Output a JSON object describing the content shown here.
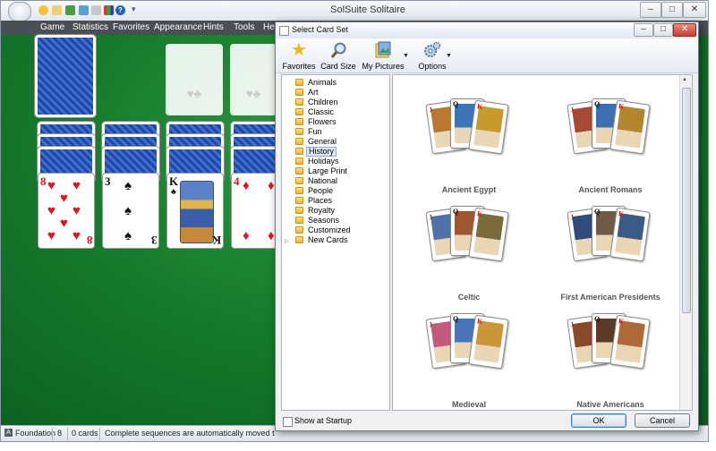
{
  "main_window": {
    "title": "SolSuite Solitaire",
    "controls": {
      "minimize": "–",
      "maximize": "□",
      "close": "✕"
    }
  },
  "menu": [
    "Game",
    "Statistics",
    "Favorites",
    "Appearance",
    "Hints",
    "Tools",
    "Help"
  ],
  "game": {
    "tableau": [
      {
        "face_rank": "8",
        "suit": "♥"
      },
      {
        "face_rank": "3",
        "suit": "♠"
      },
      {
        "face_rank": "K",
        "suit": "♣"
      },
      {
        "face_rank": "4",
        "suit": "♦"
      }
    ],
    "foundation_hints": [
      "♥♣",
      "♥♣"
    ]
  },
  "status": {
    "pile": "Foundation",
    "pile_number": "8",
    "cards": "0 cards",
    "message": "Complete sequences are automatically moved to the foundations."
  },
  "dialog": {
    "title": "Select Card Set",
    "toolbar": [
      {
        "label": "Favorites",
        "icon": "star-icon"
      },
      {
        "label": "Card Size",
        "icon": "magnifier-icon"
      },
      {
        "label": "My Pictures",
        "icon": "pictures-icon"
      },
      {
        "label": "Options",
        "icon": "gear-icon"
      }
    ],
    "categories": [
      "Animals",
      "Art",
      "Children",
      "Classic",
      "Flowers",
      "Fun",
      "General",
      "History",
      "Holidays",
      "Large Print",
      "National",
      "People",
      "Places",
      "Royalty",
      "Seasons",
      "Customized",
      "New Cards"
    ],
    "selected_category": "History",
    "card_sets": [
      {
        "name": "Ancient Egypt",
        "colors": [
          "#b9782e",
          "#3b74b7",
          "#c79a2d"
        ]
      },
      {
        "name": "Ancient Romans",
        "colors": [
          "#a64b32",
          "#3d6fb3",
          "#b3862e"
        ]
      },
      {
        "name": "Celtic",
        "colors": [
          "#4f73a8",
          "#a0562f",
          "#7a6b3b"
        ]
      },
      {
        "name": "First American Presidents",
        "colors": [
          "#2f4c7a",
          "#6f5a46",
          "#3b5a86"
        ]
      },
      {
        "name": "Medieval",
        "colors": [
          "#c25a7e",
          "#4874b9",
          "#c9963a"
        ]
      },
      {
        "name": "Native Americans",
        "colors": [
          "#8a4a2a",
          "#5b3b28",
          "#b06a3a"
        ]
      }
    ],
    "show_at_startup_label": "Show at Startup",
    "ok_label": "OK",
    "cancel_label": "Cancel"
  }
}
